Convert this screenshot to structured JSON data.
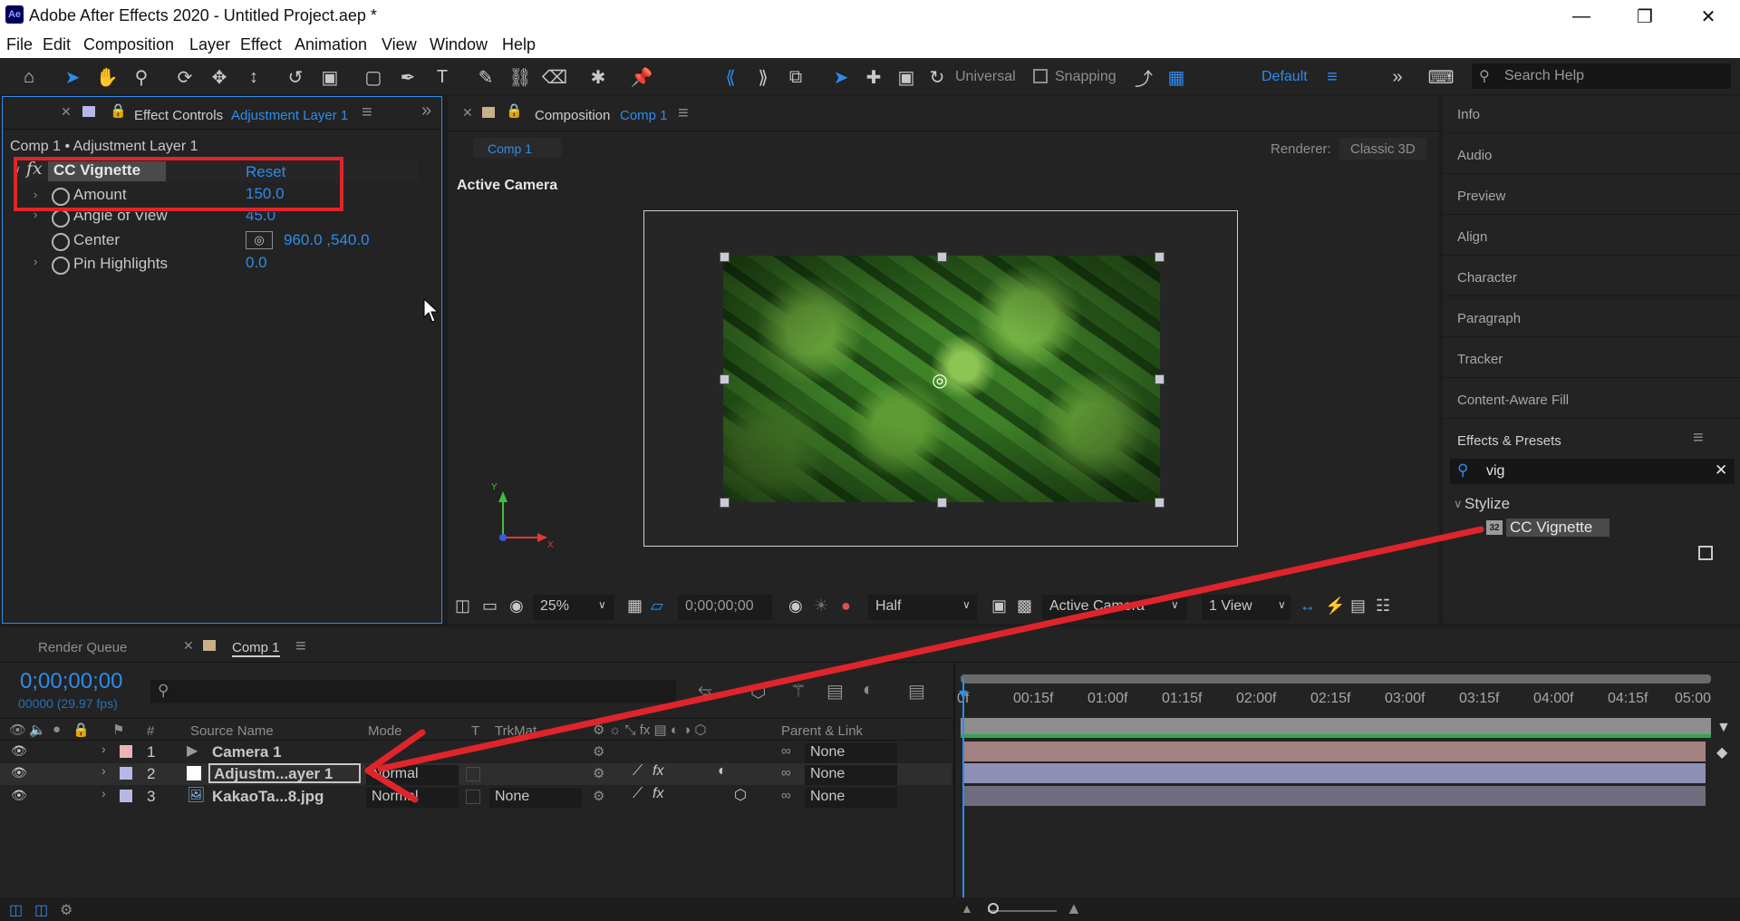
{
  "app": {
    "logo": "Ae",
    "title": "Adobe After Effects 2020 - Untitled Project.aep *",
    "window_controls": [
      "minimize-icon",
      "restore-icon",
      "close-icon"
    ]
  },
  "menu": [
    "File",
    "Edit",
    "Composition",
    "Layer",
    "Effect",
    "Animation",
    "View",
    "Window",
    "Help"
  ],
  "toolbar": {
    "universal_label": "Universal",
    "snapping_label": "Snapping",
    "workspace": "Default",
    "search_placeholder": "Search Help"
  },
  "effect_controls": {
    "tab_title": "Effect Controls",
    "tab_layer": "Adjustment Layer 1",
    "breadcrumb": "Comp 1 • Adjustment Layer 1",
    "fx_badge": "fx",
    "effect_name": "CC Vignette",
    "reset_label": "Reset",
    "properties": [
      {
        "name": "Amount",
        "value": "150.0"
      },
      {
        "name": "Angle of View",
        "value": "45.0"
      },
      {
        "name": "Center",
        "value": "960.0 ,540.0"
      },
      {
        "name": "Pin Highlights",
        "value": "0.0"
      }
    ]
  },
  "composition": {
    "tab_title": "Composition",
    "tab_comp": "Comp 1",
    "sub_tab": "Comp 1",
    "renderer_label": "Renderer:",
    "renderer_value": "Classic 3D",
    "camera_label": "Active Camera",
    "axis_y": "Y",
    "axis_x": "X",
    "zoom": "25%",
    "timecode": "0;00;00;00",
    "resolution": "Half",
    "view_camera": "Active Camera",
    "view_count": "1 View"
  },
  "right_panel": {
    "items": [
      "Info",
      "Audio",
      "Preview",
      "Align",
      "Character",
      "Paragraph",
      "Tracker",
      "Content-Aware Fill"
    ],
    "effects_presets_title": "Effects & Presets",
    "search_value": "vig",
    "category": "Stylize",
    "result_badge": "32",
    "result": "CC Vignette"
  },
  "timeline": {
    "tabs": [
      "Render Queue",
      "Comp 1"
    ],
    "timecode": "0;00;00;00",
    "frame_info": "00000 (29.97 fps)",
    "columns": {
      "num": "#",
      "source": "Source Name",
      "mode": "Mode",
      "t": "T",
      "trkmat": "TrkMat",
      "parent": "Parent & Link"
    },
    "layers": [
      {
        "num": "1",
        "name": "Camera 1",
        "mode": "",
        "trkmat": "",
        "parent": "None",
        "label_color": "#e8b4b8",
        "track_color": "#a48282"
      },
      {
        "num": "2",
        "name": "Adjustm...ayer 1",
        "mode": "Normal",
        "trkmat": "",
        "parent": "None",
        "label_color": "#b7b7e6",
        "track_color": "#8f8fb5"
      },
      {
        "num": "3",
        "name": "KakaoTa...8.jpg",
        "mode": "Normal",
        "trkmat": "None",
        "parent": "None",
        "label_color": "#b7b7e6",
        "track_color": "#6d6d7d"
      }
    ],
    "ruler": [
      "0f",
      "00:15f",
      "01:00f",
      "01:15f",
      "02:00f",
      "02:15f",
      "03:00f",
      "03:15f",
      "04:00f",
      "04:15f",
      "05:00"
    ]
  },
  "colors": {
    "accent": "#2d8ceb",
    "annotation": "#e0242b"
  }
}
